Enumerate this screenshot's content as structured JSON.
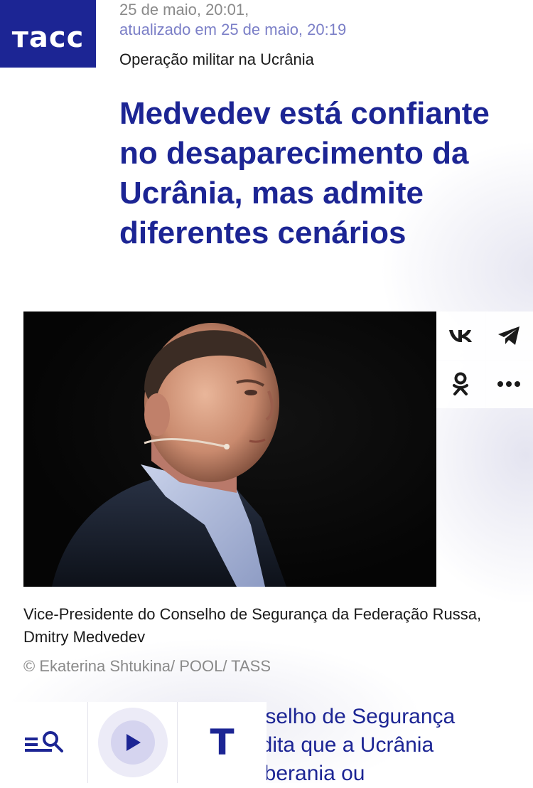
{
  "brand": {
    "logo_text": "тасс",
    "color": "#1c2594"
  },
  "article": {
    "published": "25 de maio, 20:01,",
    "updated": "atualizado em 25 de maio, 20:19",
    "rubric": "Operação militar na Ucrânia",
    "headline": "Medvedev está confiante no desaparecimento da Ucrânia, mas admite diferentes cenários",
    "photo_caption": "Vice-Presidente do Conselho de Segurança da Federação Russa, Dmitry Medvedev",
    "photo_credit": "© Ekaterina Shtukina/ POOL/ TASS",
    "teaser_lines": [
      "onselho de Segurança",
      "redita que a Ucrânia",
      "soberania ou"
    ]
  },
  "share": {
    "icons": [
      "vk-icon",
      "telegram-icon",
      "odnoklassniki-icon",
      "more-icon"
    ]
  },
  "bottom_bar": {
    "icons": [
      "menu-search-icon",
      "play-icon",
      "tass-t-icon"
    ],
    "t_letter": "T"
  },
  "colors": {
    "accent": "#1c2594",
    "muted": "#8a8a8a",
    "updated": "#7b7fc7"
  }
}
